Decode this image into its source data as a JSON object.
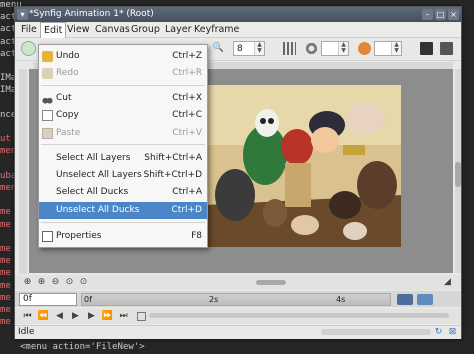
{
  "window": {
    "title": "*Synfig Animation 1* (Root)"
  },
  "background_terminal": {
    "lines": [
      {
        "text": "menu",
        "color": "#c9c9c9"
      },
      {
        "text": "acti",
        "color": "#c9c9c9"
      },
      {
        "text": "acti",
        "color": "#c9c9c9"
      },
      {
        "text": "acti",
        "color": "#c9c9c9"
      },
      {
        "text": "acti",
        "color": "#c9c9c9"
      },
      {
        "text": "",
        "color": "#c9c9c9"
      },
      {
        "text": "IMa",
        "color": "#c9c9c9"
      },
      {
        "text": "IMa",
        "color": "#c9c9c9"
      },
      {
        "text": "",
        "color": "#c9c9c9"
      },
      {
        "text": "ncel",
        "color": "#c9c9c9"
      },
      {
        "text": "",
        "color": "#c9c9c9"
      },
      {
        "text": "ut",
        "color": "#e56b6b"
      },
      {
        "text": "men",
        "color": "#e56b6b"
      },
      {
        "text": "",
        "color": "#c9c9c9"
      },
      {
        "text": "uba",
        "color": "#e56b6b"
      },
      {
        "text": "men",
        "color": "#e56b6b"
      },
      {
        "text": "",
        "color": "#c9c9c9"
      },
      {
        "text": "me",
        "color": "#e56b6b"
      },
      {
        "text": "me",
        "color": "#e56b6b"
      },
      {
        "text": "",
        "color": "#c9c9c9"
      },
      {
        "text": "me",
        "color": "#e56b6b"
      },
      {
        "text": "me",
        "color": "#e56b6b"
      },
      {
        "text": "me",
        "color": "#e56b6b"
      },
      {
        "text": "me",
        "color": "#e56b6b"
      },
      {
        "text": "me",
        "color": "#e56b6b"
      },
      {
        "text": "me",
        "color": "#e56b6b"
      },
      {
        "text": "me",
        "color": "#e56b6b"
      }
    ],
    "bottom_line": "<menu action='FileNew'>"
  },
  "menubar": {
    "items": [
      "File",
      "Edit",
      "View",
      "Canvas",
      "Group",
      "Layer",
      "Keyframe"
    ],
    "active": "Edit"
  },
  "toolbar": {
    "frame_value": "8"
  },
  "edit_menu": {
    "items": [
      {
        "label": "Undo",
        "accel": "Ctrl+Z",
        "icon": "undo-icon",
        "disabled": false,
        "highlighted": false
      },
      {
        "label": "Redo",
        "accel": "Ctrl+R",
        "icon": "redo-icon",
        "disabled": true,
        "highlighted": false
      },
      {
        "label": "Cut",
        "accel": "Ctrl+X",
        "icon": "cut-icon",
        "disabled": false,
        "highlighted": false
      },
      {
        "label": "Copy",
        "accel": "Ctrl+C",
        "icon": "copy-icon",
        "disabled": false,
        "highlighted": false
      },
      {
        "label": "Paste",
        "accel": "Ctrl+V",
        "icon": "paste-icon",
        "disabled": true,
        "highlighted": false
      },
      {
        "label": "Select All Layers",
        "accel": "Shift+Ctrl+A",
        "icon": "",
        "disabled": false,
        "highlighted": false
      },
      {
        "label": "Unselect All Layers",
        "accel": "Shift+Ctrl+D",
        "icon": "",
        "disabled": false,
        "highlighted": false
      },
      {
        "label": "Select All Ducks",
        "accel": "Ctrl+A",
        "icon": "",
        "disabled": false,
        "highlighted": false
      },
      {
        "label": "Unselect All Ducks",
        "accel": "Ctrl+D",
        "icon": "",
        "disabled": false,
        "highlighted": true
      },
      {
        "label": "Properties",
        "accel": "F8",
        "icon": "properties-icon",
        "disabled": false,
        "highlighted": false
      }
    ]
  },
  "timeline": {
    "current_frame": "0f",
    "marks": [
      "0f",
      "2s",
      "4s"
    ]
  },
  "status": {
    "text": "Idle"
  },
  "colors": {
    "highlight": "#4a86c8",
    "titlebar": "#4f5b69"
  }
}
